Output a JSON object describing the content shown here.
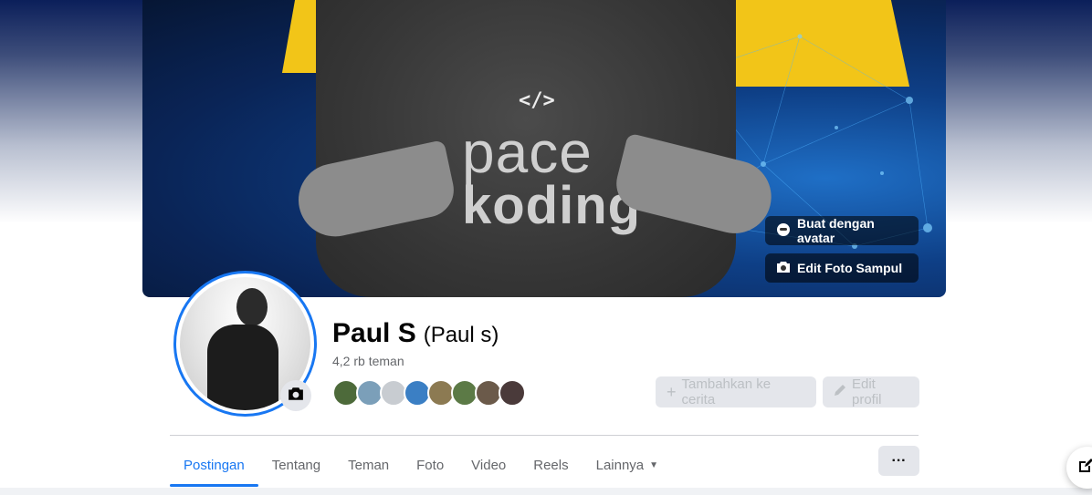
{
  "cover": {
    "shirt_logo": "</>",
    "shirt_line1": "pace",
    "shirt_line2": "koding",
    "avatar_button": "Buat dengan avatar",
    "edit_cover_button": "Edit Foto Sampul"
  },
  "profile": {
    "name": "Paul S",
    "alt_name": "(Paul s)",
    "friends_count": "4,2 rb teman"
  },
  "friend_avatar_colors": [
    "#4d6a3a",
    "#7b9fb9",
    "#c8ccd1",
    "#3b7fc4",
    "#8c7a52",
    "#5c7a46",
    "#6b5a4a",
    "#4a3a3a"
  ],
  "actions": {
    "add_story": "Tambahkan ke cerita",
    "edit_profile": "Edit profil"
  },
  "tabs": [
    {
      "label": "Postingan",
      "active": true
    },
    {
      "label": "Tentang"
    },
    {
      "label": "Teman"
    },
    {
      "label": "Foto"
    },
    {
      "label": "Video"
    },
    {
      "label": "Reels"
    },
    {
      "label": "Lainnya"
    }
  ],
  "more_label": "···",
  "colors": {
    "accent": "#1877f2",
    "cover_yellow": "#f2c518",
    "button_gray": "#e4e6eb"
  },
  "icons": {
    "avatar_button": "avatar-icon",
    "edit_cover": "camera-icon",
    "profile_camera": "camera-icon",
    "add_story": "plus-icon",
    "edit_profile": "pencil-icon",
    "lainnya_caret": "caret-down-icon",
    "compose": "compose-icon"
  }
}
